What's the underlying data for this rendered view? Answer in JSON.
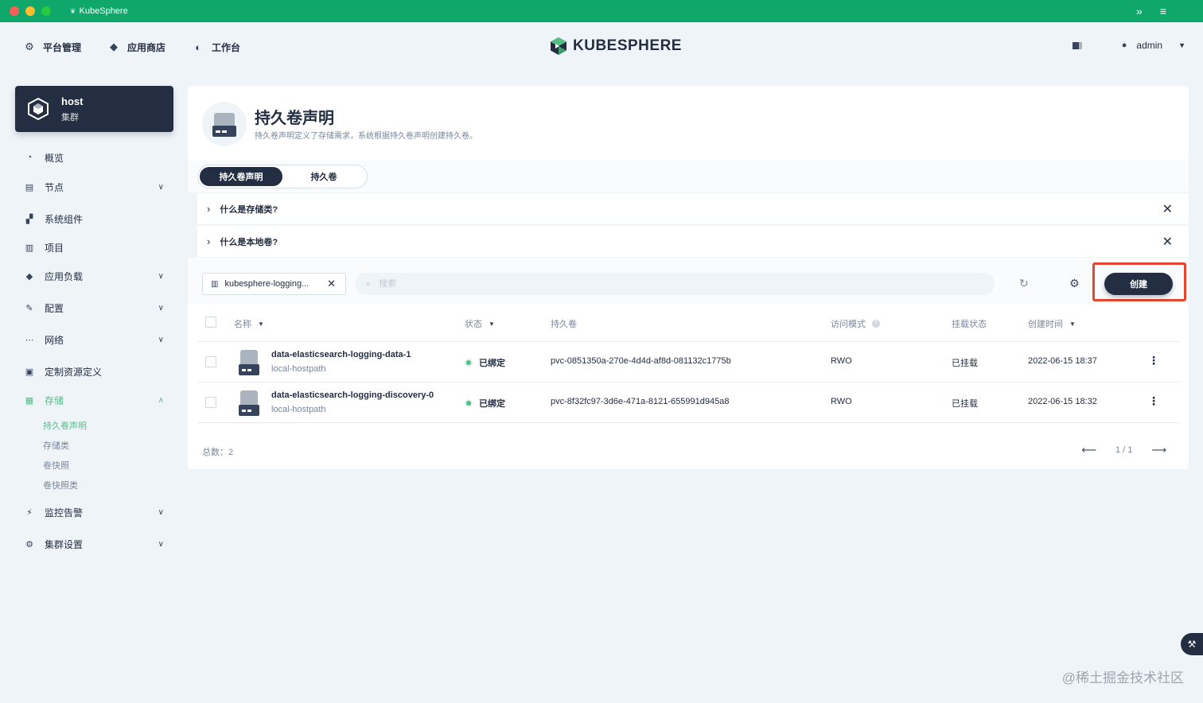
{
  "window": {
    "app_title": "KubeSphere",
    "title_icon": "leaf-icon"
  },
  "topnav": [
    {
      "label": "平台管理",
      "icon": "⚙"
    },
    {
      "label": "应用商店",
      "icon": "◆"
    },
    {
      "label": "工作台",
      "icon": "◐"
    }
  ],
  "logo": {
    "text": "KUBESPHERE"
  },
  "user": {
    "name": "admin"
  },
  "cluster": {
    "name": "host",
    "type": "集群"
  },
  "sidebar": {
    "items": [
      {
        "label": "概览",
        "icon": "◔"
      },
      {
        "label": "节点",
        "icon": "▤"
      },
      {
        "label": "系统组件",
        "icon": "▞"
      },
      {
        "label": "项目",
        "icon": "▥"
      },
      {
        "label": "应用负载",
        "icon": "◆"
      },
      {
        "label": "配置",
        "icon": "✎"
      },
      {
        "label": "网络",
        "icon": "⋯"
      },
      {
        "label": "定制资源定义",
        "icon": "▣"
      },
      {
        "label": "存储",
        "icon": "▦"
      },
      {
        "label": "监控告警",
        "icon": "⚡"
      },
      {
        "label": "集群设置",
        "icon": "⚙"
      }
    ],
    "storage_sub": [
      "持久卷声明",
      "存储类",
      "卷快照",
      "卷快照类"
    ]
  },
  "page": {
    "title": "持久卷声明",
    "description": "持久卷声明定义了存储需求，系统根据持久卷声明创建持久卷。"
  },
  "tabs": [
    {
      "label": "持久卷声明"
    },
    {
      "label": "持久卷"
    }
  ],
  "faq": [
    {
      "question": "什么是存储类?"
    },
    {
      "question": "什么是本地卷?"
    }
  ],
  "toolbar": {
    "namespace": "kubesphere-logging...",
    "search_placeholder": "搜索",
    "create_label": "创建"
  },
  "table": {
    "headers": {
      "name": "名称",
      "status": "状态",
      "volume": "持久卷",
      "access_mode": "访问模式",
      "mount_status": "挂载状态",
      "created": "创建时间"
    },
    "rows": [
      {
        "name": "data-elasticsearch-logging-data-1",
        "storage_class": "local-hostpath",
        "status": "已绑定",
        "volume": "pvc-0851350a-270e-4d4d-af8d-081132c1775b",
        "access_mode": "RWO",
        "mount_status": "已挂载",
        "created": "2022-06-15 18:37"
      },
      {
        "name": "data-elasticsearch-logging-discovery-0",
        "storage_class": "local-hostpath",
        "status": "已绑定",
        "volume": "pvc-8f32fc97-3d6e-471a-8121-655991d945a8",
        "access_mode": "RWO",
        "mount_status": "已挂载",
        "created": "2022-06-15 18:32"
      }
    ]
  },
  "footer": {
    "total": "总数：2",
    "page": "1 / 1"
  },
  "watermark": "@稀土掘金技术社区",
  "colors": {
    "titlebar": "#10a86a",
    "accent": "#55bc8a",
    "dark": "#242e42",
    "highlight": "#e6452f"
  }
}
